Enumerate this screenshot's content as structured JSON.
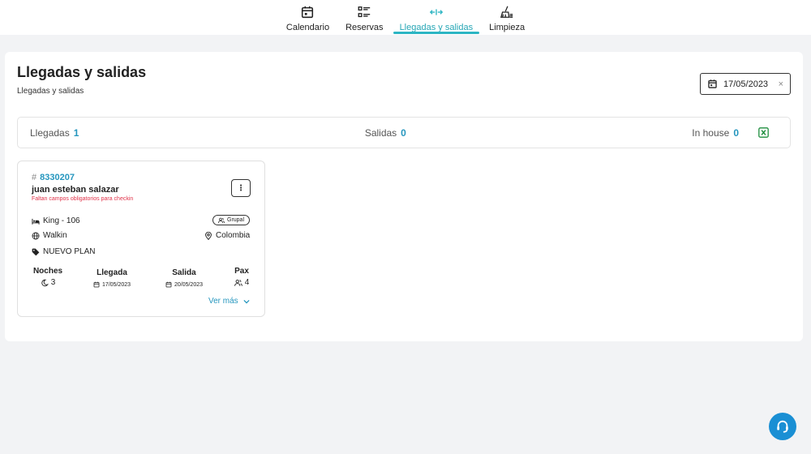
{
  "nav": {
    "items": [
      {
        "label": "Calendario",
        "icon": "calendar-icon",
        "active": false
      },
      {
        "label": "Reservas",
        "icon": "list-icon",
        "active": false
      },
      {
        "label": "Llegadas y salidas",
        "icon": "arrows-icon",
        "active": true
      },
      {
        "label": "Limpieza",
        "icon": "broom-icon",
        "active": false
      }
    ],
    "accent": "#2cb5c3"
  },
  "page": {
    "title": "Llegadas y salidas",
    "subtitle": "Llegadas y salidas"
  },
  "date_filter": {
    "value": "17/05/2023",
    "clear": "×"
  },
  "summary": {
    "arrivals_label": "Llegadas",
    "arrivals_count": "1",
    "departures_label": "Salidas",
    "departures_count": "0",
    "inhouse_label": "In house",
    "inhouse_count": "0"
  },
  "card": {
    "hash": "#",
    "reservation_id": "8330207",
    "guest_name": "juan esteban salazar",
    "warning": "Faltan campos obligatorios para checkin",
    "more": "⋮",
    "room": "King - 106",
    "badge": "Grupal",
    "channel": "Walkin",
    "country": "Colombia",
    "plan": "NUEVO PLAN",
    "nights_label": "Noches",
    "nights": "3",
    "arrival_label": "Llegada",
    "arrival": "17/05/2023",
    "departure_label": "Salida",
    "departure": "20/05/2023",
    "pax_label": "Pax",
    "pax": "4",
    "see_more": "Ver más"
  },
  "colors": {
    "link": "#2596be",
    "warning": "#e0334a",
    "fab": "#1a8fd4",
    "excel": "#1e8e3e"
  }
}
